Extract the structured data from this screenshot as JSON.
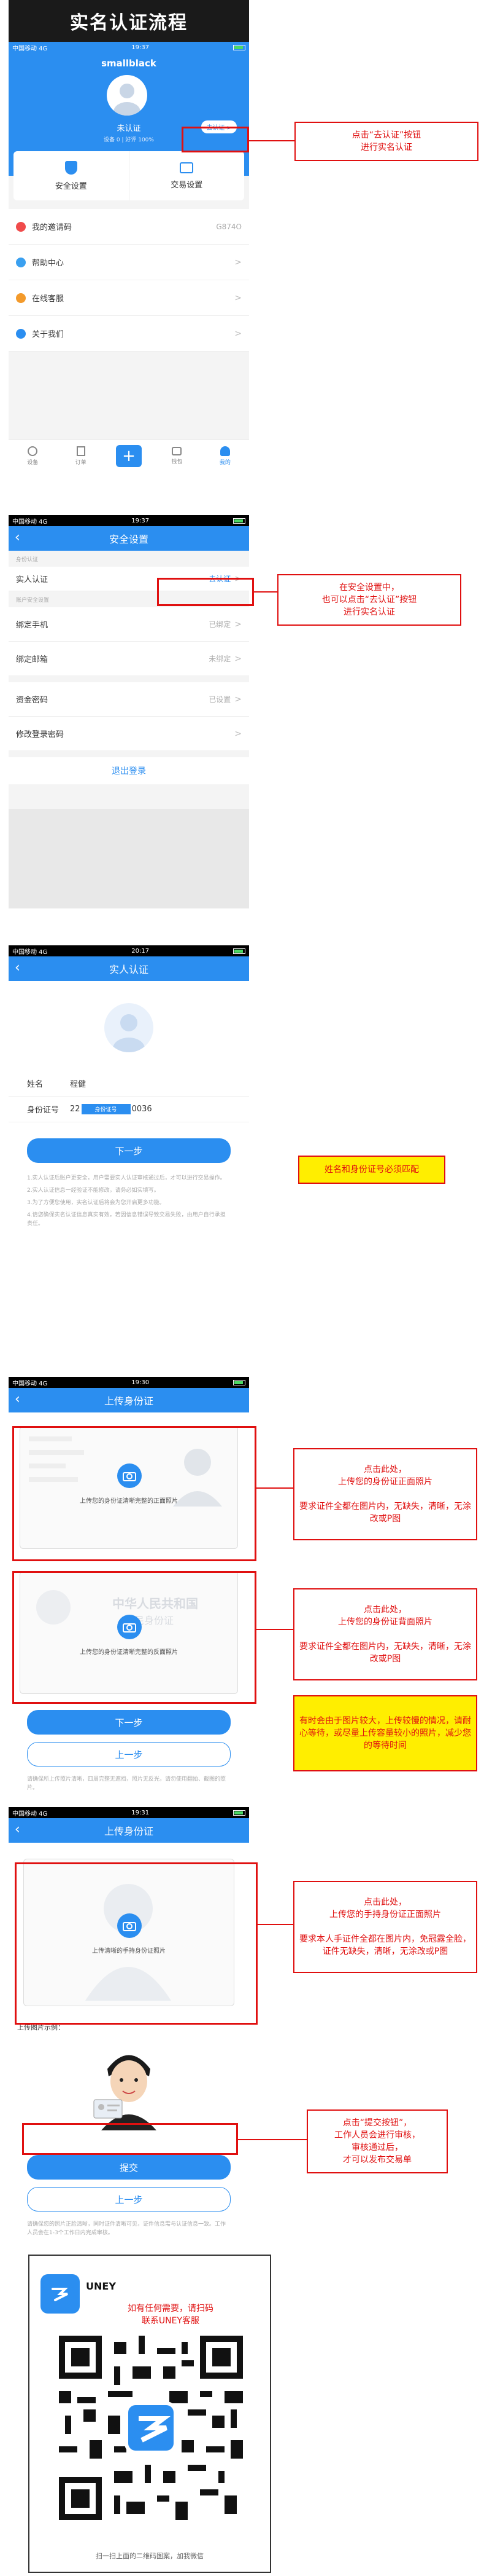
{
  "page_title": "实名认证流程",
  "status_bar": {
    "carrier": "中国移动 4G",
    "time1": "19:37",
    "time2": "19:37",
    "time3": "20:17",
    "time4": "19:30",
    "time5": "19:31"
  },
  "profile": {
    "username": "smallblack",
    "status": "未认证",
    "verify_button": "去认证 >",
    "stats": "设备 0 | 好评 100%",
    "security_label": "安全设置",
    "trade_label": "交易设置"
  },
  "menu": [
    {
      "label": "我的邀请码",
      "value": "G874O"
    },
    {
      "label": "帮助中心",
      "value": ""
    },
    {
      "label": "在线客服",
      "value": ""
    },
    {
      "label": "关于我们",
      "value": ""
    }
  ],
  "tabbar": [
    "设备",
    "订单",
    "",
    "钱包",
    "我的"
  ],
  "notes": {
    "n1": "点击“去认证”按钮\n进行实名认证",
    "n2": "在安全设置中，\n也可以点击“去认证”按钮\n进行实名认证",
    "n3": "姓名和身份证号必须匹配",
    "n4": "点击此处，\n上传您的身份证正面照片\n\n要求证件全都在图片内，无缺失，清晰，无涂改或P图",
    "n5": "点击此处，\n上传您的身份证背面照片\n\n要求证件全都在图片内，无缺失，清晰，无涂改或P图",
    "n6": "有时会由于图片较大，上传较慢的情况，请耐心等待，或尽量上传容量较小的照片，减少您的等待时间",
    "n7": "点击此处，\n上传您的手持身份证正面照片\n\n要求本人手证件全都在图片内，免冠露全脸，证件无缺失，清晰，无涂改或P图",
    "n8": "点击“提交按钮”，\n工作人员会进行审核，\n审核通过后，\n才可以发布交易单"
  },
  "security": {
    "title": "安全设置",
    "section1": "身份认证",
    "realname": "实人认证",
    "realname_action": "去认证",
    "section2": "账户安全设置",
    "rows": [
      {
        "label": "绑定手机",
        "value": "已绑定"
      },
      {
        "label": "绑定邮箱",
        "value": "未绑定"
      },
      {
        "label": "资金密码",
        "value": "已设置"
      },
      {
        "label": "修改登录密码",
        "value": ""
      }
    ],
    "logout": "退出登录"
  },
  "realname_page": {
    "title": "实人认证",
    "name_label": "姓名",
    "name_value": "程健",
    "id_label": "身份证号",
    "id_prefix": "22",
    "id_highlight": "身份证号",
    "id_suffix": "0036",
    "next": "下一步",
    "tips": [
      "1.实人认证后账户更安全，用户需要实人认证审核通过后，才可以进行交易操作。",
      "2.实人认证信息一经验证不能修改，请务必如实填写。",
      "3.为了方便您使用，实名认证后将会为您开启更多功能。",
      "4.请您确保实名认证信息真实有效，若因信息错误导致交易失败，由用户自行承担责任。"
    ]
  },
  "upload_page": {
    "title": "上传身份证",
    "front_caption": "上传您的身份证清晰完整的正面照片",
    "back_caption": "上传您的身份证清晰完整的反面照片",
    "back_text": "中华人民共和国",
    "back_text2": "居民身份证",
    "next": "下一步",
    "prev": "上一步",
    "tip": "请确保所上传照片清晰，四周完整无遮挡，照片无反光，请勿使用翻拍、截图的照片。"
  },
  "handheld_page": {
    "title": "上传身份证",
    "caption": "上传清晰的手持身份证照片",
    "example_label": "上传图片示例：",
    "submit": "提交",
    "prev": "上一步",
    "tip": "请确保您的照片正脸清晰，同时证件清晰可见，证件信息需与认证信息一致。工作人员会在1-3个工作日内完成审核。"
  },
  "qr_card": {
    "brand": "UNEY",
    "note": "如有任何需要，请扫码\n联系UNEY客服",
    "footer": "扫一扫上面的二维码图案，加我微信"
  }
}
